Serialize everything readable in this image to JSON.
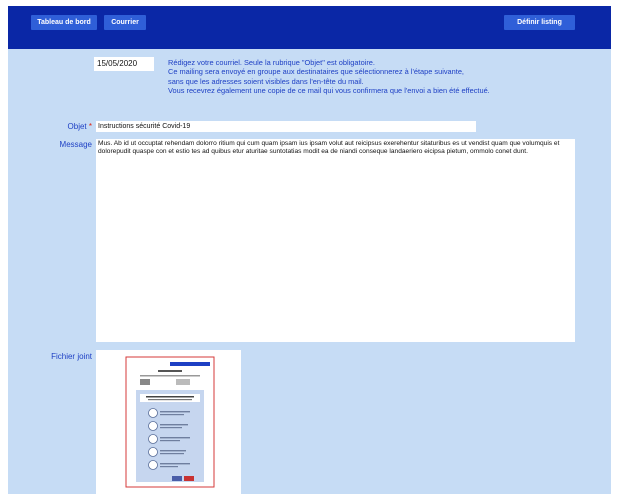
{
  "nav": {
    "dashboard": "Tableau de bord",
    "mail": "Courrier",
    "define_listing": "Définir listing"
  },
  "compose": {
    "date": "15/05/2020",
    "intro_lines": [
      "Rédigez votre courriel. Seule la rubrique \"Objet\" est obligatoire.",
      "Ce mailing sera envoyé en groupe aux destinataires que sélectionnerez à l'étape suivante,",
      "sans que les adresses soient visibles dans l'en-tête du mail.",
      "Vous recevrez également une copie de ce mail qui vous confirmera que l'envoi a bien été effectué."
    ],
    "subject_label": "Objet",
    "required_mark": "*",
    "subject_value": "Instructions sécurité Covid-19",
    "message_label": "Message",
    "message_value": "Mus. Ab id ut occuptat rehendam dolorro ritium qui cum quam ipsam ius ipsam volut aut reicipsus exerehentur sitaturibus es ut vendist quam que volumquis et dolorepudit quaspe con et estio tes ad quibus etur aturitae suntotatias modit ea de niandi conseque landaeriero eicipsa pietum, ommolo conet dunt.",
    "attachment_label": "Fichier joint"
  },
  "colors": {
    "topbar": "#0a27a6",
    "nav_button": "#2f5fd8",
    "background": "#c6dcf5",
    "label_text": "#1d3fc4"
  }
}
